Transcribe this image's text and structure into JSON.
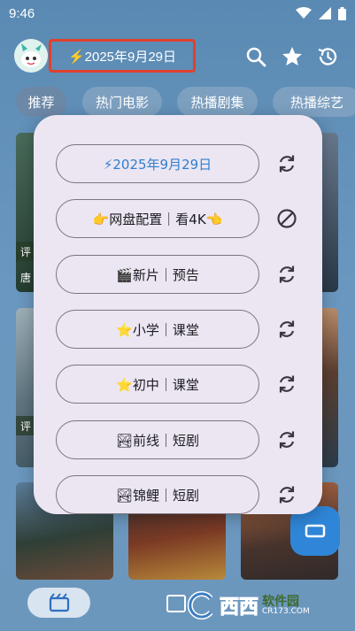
{
  "status_bar": {
    "time": "9:46"
  },
  "header": {
    "title": "⚡2025年9月29日"
  },
  "tabs": [
    {
      "label": "推荐",
      "active": true
    },
    {
      "label": "热门电影",
      "active": false
    },
    {
      "label": "热播剧集",
      "active": false
    },
    {
      "label": "热播综艺",
      "active": false
    }
  ],
  "posters": {
    "strip_labels": [
      "评",
      "唐",
      "评",
      "评"
    ]
  },
  "dialog": {
    "items": [
      {
        "label": "⚡2025年9月29日",
        "action_icon": "refresh-icon"
      },
      {
        "label": "👉网盘配置｜看4K👈",
        "action_icon": "block-icon"
      },
      {
        "label": "🎬新片｜预告",
        "action_icon": "refresh-icon"
      },
      {
        "label": "⭐小学｜课堂",
        "action_icon": "refresh-icon"
      },
      {
        "label": "⭐初中｜课堂",
        "action_icon": "refresh-icon"
      },
      {
        "label": "🏞前线｜短剧",
        "action_icon": "refresh-icon"
      },
      {
        "label": "🏞锦鲤｜短剧",
        "action_icon": "refresh-icon"
      }
    ]
  },
  "watermark": {
    "text": "西西",
    "sub": "软件园",
    "domain": "CR173.COM"
  },
  "colors": {
    "accent": "#2f7fd0",
    "title_outline": "#e0402c",
    "dialog_bg": "#ece6f2"
  }
}
